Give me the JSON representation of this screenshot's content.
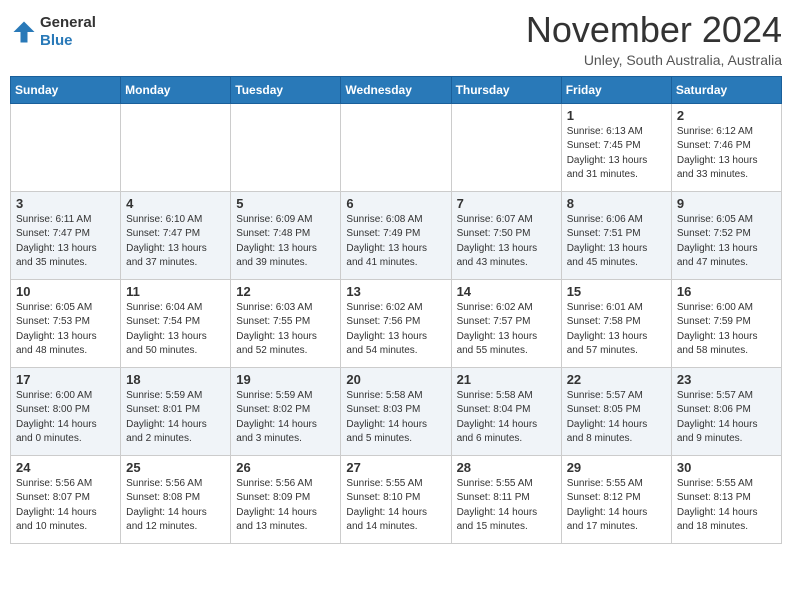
{
  "header": {
    "logo_line1": "General",
    "logo_line2": "Blue",
    "month": "November 2024",
    "location": "Unley, South Australia, Australia"
  },
  "weekdays": [
    "Sunday",
    "Monday",
    "Tuesday",
    "Wednesday",
    "Thursday",
    "Friday",
    "Saturday"
  ],
  "weeks": [
    [
      {
        "day": "",
        "info": ""
      },
      {
        "day": "",
        "info": ""
      },
      {
        "day": "",
        "info": ""
      },
      {
        "day": "",
        "info": ""
      },
      {
        "day": "",
        "info": ""
      },
      {
        "day": "1",
        "info": "Sunrise: 6:13 AM\nSunset: 7:45 PM\nDaylight: 13 hours\nand 31 minutes."
      },
      {
        "day": "2",
        "info": "Sunrise: 6:12 AM\nSunset: 7:46 PM\nDaylight: 13 hours\nand 33 minutes."
      }
    ],
    [
      {
        "day": "3",
        "info": "Sunrise: 6:11 AM\nSunset: 7:47 PM\nDaylight: 13 hours\nand 35 minutes."
      },
      {
        "day": "4",
        "info": "Sunrise: 6:10 AM\nSunset: 7:47 PM\nDaylight: 13 hours\nand 37 minutes."
      },
      {
        "day": "5",
        "info": "Sunrise: 6:09 AM\nSunset: 7:48 PM\nDaylight: 13 hours\nand 39 minutes."
      },
      {
        "day": "6",
        "info": "Sunrise: 6:08 AM\nSunset: 7:49 PM\nDaylight: 13 hours\nand 41 minutes."
      },
      {
        "day": "7",
        "info": "Sunrise: 6:07 AM\nSunset: 7:50 PM\nDaylight: 13 hours\nand 43 minutes."
      },
      {
        "day": "8",
        "info": "Sunrise: 6:06 AM\nSunset: 7:51 PM\nDaylight: 13 hours\nand 45 minutes."
      },
      {
        "day": "9",
        "info": "Sunrise: 6:05 AM\nSunset: 7:52 PM\nDaylight: 13 hours\nand 47 minutes."
      }
    ],
    [
      {
        "day": "10",
        "info": "Sunrise: 6:05 AM\nSunset: 7:53 PM\nDaylight: 13 hours\nand 48 minutes."
      },
      {
        "day": "11",
        "info": "Sunrise: 6:04 AM\nSunset: 7:54 PM\nDaylight: 13 hours\nand 50 minutes."
      },
      {
        "day": "12",
        "info": "Sunrise: 6:03 AM\nSunset: 7:55 PM\nDaylight: 13 hours\nand 52 minutes."
      },
      {
        "day": "13",
        "info": "Sunrise: 6:02 AM\nSunset: 7:56 PM\nDaylight: 13 hours\nand 54 minutes."
      },
      {
        "day": "14",
        "info": "Sunrise: 6:02 AM\nSunset: 7:57 PM\nDaylight: 13 hours\nand 55 minutes."
      },
      {
        "day": "15",
        "info": "Sunrise: 6:01 AM\nSunset: 7:58 PM\nDaylight: 13 hours\nand 57 minutes."
      },
      {
        "day": "16",
        "info": "Sunrise: 6:00 AM\nSunset: 7:59 PM\nDaylight: 13 hours\nand 58 minutes."
      }
    ],
    [
      {
        "day": "17",
        "info": "Sunrise: 6:00 AM\nSunset: 8:00 PM\nDaylight: 14 hours\nand 0 minutes."
      },
      {
        "day": "18",
        "info": "Sunrise: 5:59 AM\nSunset: 8:01 PM\nDaylight: 14 hours\nand 2 minutes."
      },
      {
        "day": "19",
        "info": "Sunrise: 5:59 AM\nSunset: 8:02 PM\nDaylight: 14 hours\nand 3 minutes."
      },
      {
        "day": "20",
        "info": "Sunrise: 5:58 AM\nSunset: 8:03 PM\nDaylight: 14 hours\nand 5 minutes."
      },
      {
        "day": "21",
        "info": "Sunrise: 5:58 AM\nSunset: 8:04 PM\nDaylight: 14 hours\nand 6 minutes."
      },
      {
        "day": "22",
        "info": "Sunrise: 5:57 AM\nSunset: 8:05 PM\nDaylight: 14 hours\nand 8 minutes."
      },
      {
        "day": "23",
        "info": "Sunrise: 5:57 AM\nSunset: 8:06 PM\nDaylight: 14 hours\nand 9 minutes."
      }
    ],
    [
      {
        "day": "24",
        "info": "Sunrise: 5:56 AM\nSunset: 8:07 PM\nDaylight: 14 hours\nand 10 minutes."
      },
      {
        "day": "25",
        "info": "Sunrise: 5:56 AM\nSunset: 8:08 PM\nDaylight: 14 hours\nand 12 minutes."
      },
      {
        "day": "26",
        "info": "Sunrise: 5:56 AM\nSunset: 8:09 PM\nDaylight: 14 hours\nand 13 minutes."
      },
      {
        "day": "27",
        "info": "Sunrise: 5:55 AM\nSunset: 8:10 PM\nDaylight: 14 hours\nand 14 minutes."
      },
      {
        "day": "28",
        "info": "Sunrise: 5:55 AM\nSunset: 8:11 PM\nDaylight: 14 hours\nand 15 minutes."
      },
      {
        "day": "29",
        "info": "Sunrise: 5:55 AM\nSunset: 8:12 PM\nDaylight: 14 hours\nand 17 minutes."
      },
      {
        "day": "30",
        "info": "Sunrise: 5:55 AM\nSunset: 8:13 PM\nDaylight: 14 hours\nand 18 minutes."
      }
    ]
  ]
}
